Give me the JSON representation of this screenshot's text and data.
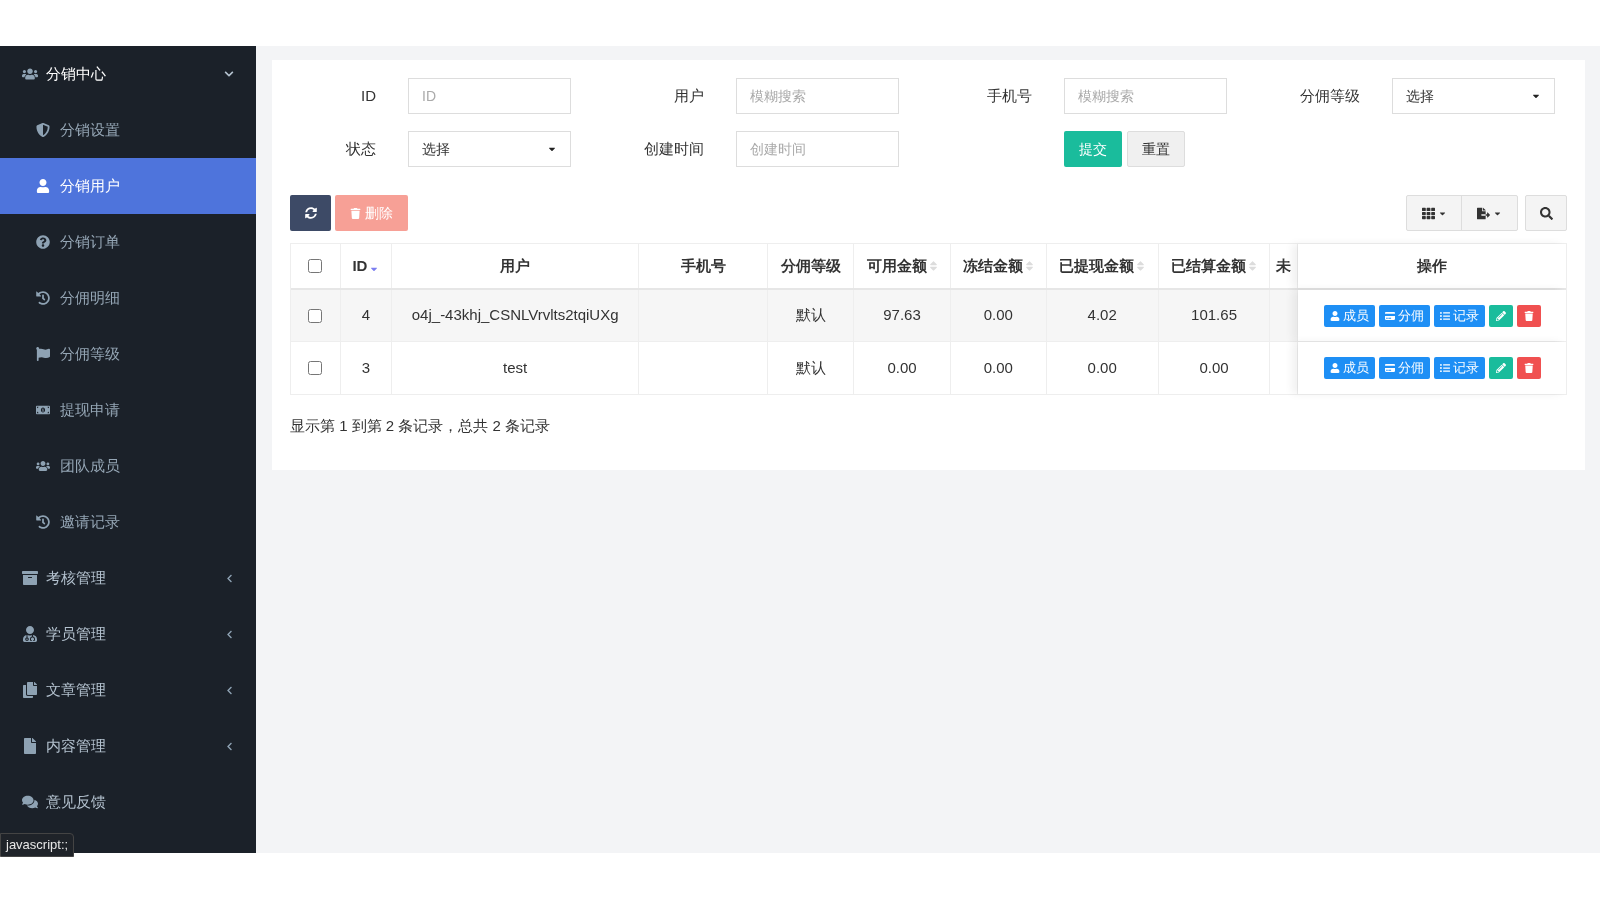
{
  "sidebar": {
    "items": [
      {
        "label": "分销中心",
        "kind": "group",
        "expanded": true,
        "children": [
          {
            "label": "分销设置",
            "selected": false
          },
          {
            "label": "分销用户",
            "selected": true
          },
          {
            "label": "分销订单",
            "selected": false
          },
          {
            "label": "分佣明细",
            "selected": false
          },
          {
            "label": "分佣等级",
            "selected": false
          },
          {
            "label": "提现申请",
            "selected": false
          },
          {
            "label": "团队成员",
            "selected": false
          },
          {
            "label": "邀请记录",
            "selected": false
          }
        ]
      },
      {
        "label": "考核管理",
        "kind": "group",
        "expanded": false
      },
      {
        "label": "学员管理",
        "kind": "group",
        "expanded": false
      },
      {
        "label": "文章管理",
        "kind": "group",
        "expanded": false
      },
      {
        "label": "内容管理",
        "kind": "group",
        "expanded": false
      },
      {
        "label": "意见反馈",
        "kind": "link"
      }
    ]
  },
  "filters": [
    {
      "label": "ID",
      "kind": "text",
      "placeholder": "ID"
    },
    {
      "label": "用户",
      "kind": "text",
      "placeholder": "模糊搜索"
    },
    {
      "label": "手机号",
      "kind": "text",
      "placeholder": "模糊搜索"
    },
    {
      "label": "分佣等级",
      "kind": "select",
      "value": "选择"
    },
    {
      "label": "状态",
      "kind": "select",
      "value": "选择"
    },
    {
      "label": "创建时间",
      "kind": "text",
      "placeholder": "创建时间"
    }
  ],
  "filter_buttons": {
    "submit": "提交",
    "reset": "重置"
  },
  "toolbar": {
    "delete": "删除",
    "delete_disabled": true
  },
  "table": {
    "columns": [
      {
        "label": "ID",
        "sortable": true,
        "sorted": true
      },
      {
        "label": "用户",
        "sortable": false
      },
      {
        "label": "手机号",
        "sortable": false
      },
      {
        "label": "分佣等级",
        "sortable": false
      },
      {
        "label": "可用金额",
        "sortable": true,
        "sorted": false
      },
      {
        "label": "冻结金额",
        "sortable": true,
        "sorted": false
      },
      {
        "label": "已提现金额",
        "sortable": true,
        "sorted": false
      },
      {
        "label": "已结算金额",
        "sortable": true,
        "sorted": false
      },
      {
        "label": "未",
        "sortable": false
      },
      {
        "label": "操作",
        "sortable": false
      }
    ],
    "rows": [
      {
        "checked": false,
        "cells": [
          "4",
          "o4j_-43khj_CSNLVrvlts2tqiUXg",
          "",
          "默认",
          "97.63",
          "0.00",
          "4.02",
          "101.65",
          ""
        ],
        "actions": [
          "成员",
          "分佣",
          "记录"
        ]
      },
      {
        "checked": false,
        "cells": [
          "3",
          "test",
          "",
          "默认",
          "0.00",
          "0.00",
          "0.00",
          "0.00",
          ""
        ],
        "actions": [
          "成员",
          "分佣",
          "记录"
        ]
      }
    ],
    "all_checked": false
  },
  "pagination_info": "显示第 1 到第 2 条记录，总共 2 条记录",
  "status_tooltip": "javascript:;"
}
